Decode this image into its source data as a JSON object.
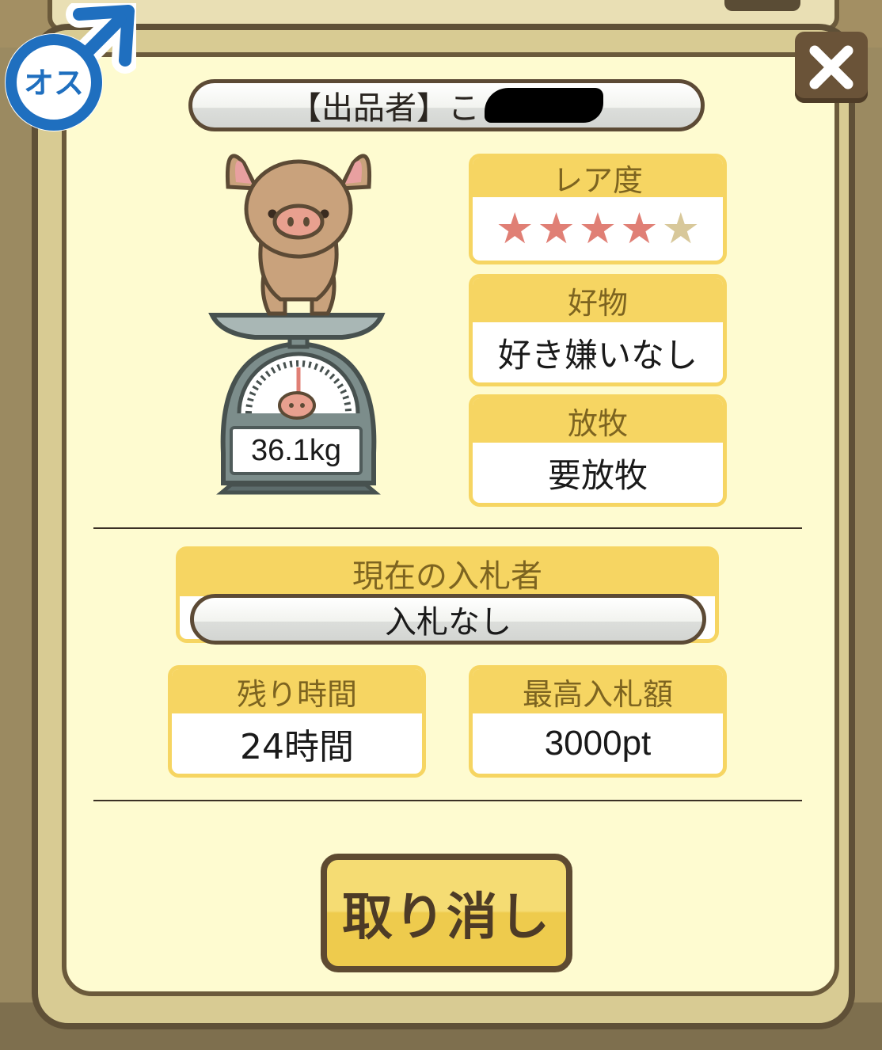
{
  "seller": {
    "label": "【出品者】こ"
  },
  "badge": {
    "gender_label": "オス"
  },
  "pig": {
    "weight": "36.1kg"
  },
  "rarity": {
    "header": "レア度",
    "rating": 4,
    "max": 5
  },
  "favorite": {
    "header": "好物",
    "value": "好き嫌いなし"
  },
  "grazing": {
    "header": "放牧",
    "value": "要放牧"
  },
  "bidder": {
    "header": "現在の入札者",
    "value": "入札なし"
  },
  "remaining": {
    "header": "残り時間",
    "value": "24時間"
  },
  "top_bid": {
    "header": "最高入札額",
    "value": "3000pt"
  },
  "actions": {
    "cancel_label": "取り消し"
  },
  "colors": {
    "accent": "#f6d562",
    "frame": "#6b5a3b",
    "panel": "#fefbd0",
    "star_on": "#e07f75",
    "star_off": "#d8c89a",
    "male_blue": "#1f6fbf"
  }
}
